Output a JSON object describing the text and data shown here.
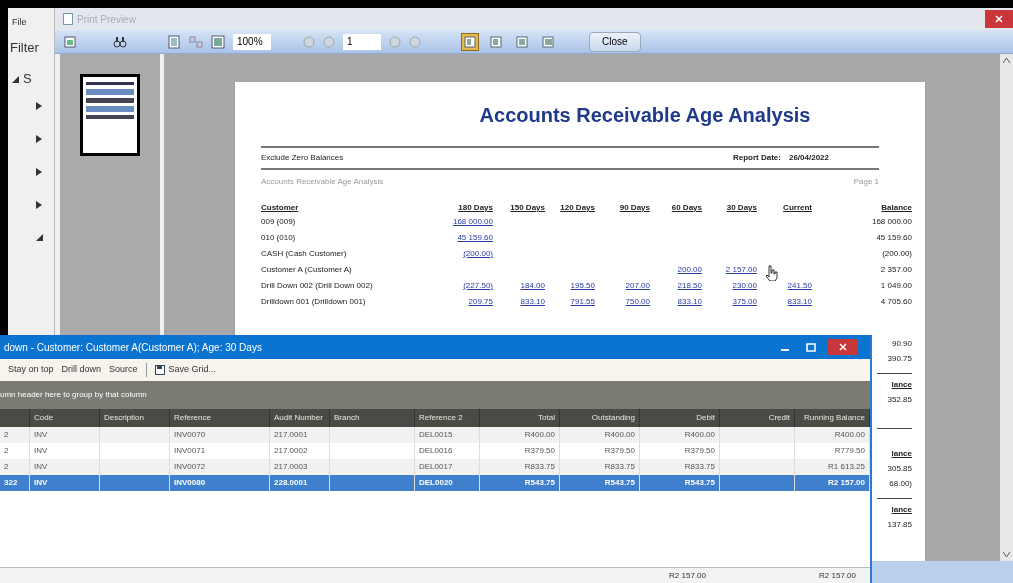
{
  "app_menu": {
    "file": "File",
    "filter": "Filter"
  },
  "tree": [
    {
      "label": "S",
      "expanded": true,
      "children": [
        {
          "expanded": false
        },
        {
          "expanded": false
        },
        {
          "expanded": false
        },
        {
          "expanded": false
        },
        {
          "expanded": true
        }
      ]
    }
  ],
  "preview": {
    "title": "Print Preview",
    "zoom": "100%",
    "page": "1",
    "close": "Close",
    "view_modes": [
      {
        "selected": true
      },
      {
        "selected": false
      },
      {
        "selected": false
      },
      {
        "selected": false
      }
    ]
  },
  "report": {
    "title": "Accounts Receivable Age Analysis",
    "filter": "Exclude Zero Balances",
    "report_date_label": "Report Date:",
    "report_date": "26/04/2022",
    "subtitle": "Accounts Receivable Age Analysis",
    "page": "Page 1",
    "columns": [
      "Customer",
      "180 Days",
      "150 Days",
      "120 Days",
      "90 Days",
      "60 Days",
      "30 Days",
      "Current",
      "Balance"
    ],
    "rows": [
      {
        "cells": [
          "009 (009)",
          "168 000.00",
          null,
          null,
          null,
          null,
          null,
          null,
          "168 000.00"
        ]
      },
      {
        "cells": [
          "010 (010)",
          "45 159.60",
          null,
          null,
          null,
          null,
          null,
          null,
          "45 159.60"
        ]
      },
      {
        "cells": [
          "CASH (Cash Customer)",
          "(200.00)",
          null,
          null,
          null,
          null,
          null,
          null,
          "(200.00)"
        ]
      },
      {
        "cells": [
          "Customer A (Customer A)",
          null,
          null,
          null,
          null,
          "200.00",
          "2 157.00",
          null,
          "2 357.00"
        ]
      },
      {
        "cells": [
          "Drill Down 002 (Drill Down 002)",
          "(227.50)",
          "184.00",
          "195.50",
          "207.00",
          "218.50",
          "230.00",
          "241.50",
          "1 049.00"
        ]
      },
      {
        "cells": [
          "Drilldown 001 (Drilldown 001)",
          "209.75",
          "833.10",
          "791.55",
          "750.00",
          "833.10",
          "375.00",
          "833.10",
          "4 705.60"
        ]
      }
    ],
    "fragments": [
      {
        "kind": "amount",
        "text": "90.90"
      },
      {
        "kind": "amount",
        "text": "390.75"
      },
      {
        "kind": "rule"
      },
      {
        "kind": "heading",
        "text": "lance"
      },
      {
        "kind": "amount",
        "text": "352.85"
      },
      {
        "kind": "gap"
      },
      {
        "kind": "rule"
      },
      {
        "kind": "gap"
      },
      {
        "kind": "heading",
        "text": "lance"
      },
      {
        "kind": "amount",
        "text": "305.85"
      },
      {
        "kind": "amount",
        "text": "68.00)"
      },
      {
        "kind": "rule"
      },
      {
        "kind": "heading",
        "text": "lance"
      },
      {
        "kind": "amount",
        "text": "137.85"
      }
    ]
  },
  "drilldown": {
    "title": "down - Customer: Customer A(Customer A); Age: 30 Days",
    "toolbar": [
      "Stay on top",
      "Drill down",
      "Source"
    ],
    "save": "Save Grid...",
    "group_hint": "umn header here to group by that column",
    "columns": [
      "Code",
      "Description",
      "Reference",
      "Audit Number",
      "Branch",
      "Reference 2",
      "Total",
      "Outstanding",
      "Debit",
      "Credit",
      "Running Balance"
    ],
    "rows": [
      {
        "selected": false,
        "row_label": "2",
        "cells": [
          "INV",
          null,
          "INV0070",
          "217.0001",
          null,
          "DEL0015",
          "R400.00",
          "R400.00",
          "R400.00",
          null,
          "R400.00"
        ]
      },
      {
        "selected": false,
        "row_label": "2",
        "cells": [
          "INV",
          null,
          "INV0071",
          "217.0002",
          null,
          "DEL0016",
          "R379.50",
          "R379.50",
          "R379.50",
          null,
          "R779.50"
        ]
      },
      {
        "selected": false,
        "row_label": "2",
        "cells": [
          "INV",
          null,
          "INV0072",
          "217.0003",
          null,
          "DEL0017",
          "R833.75",
          "R833.75",
          "R833.75",
          null,
          "R1 613.25"
        ]
      },
      {
        "selected": true,
        "row_label": "322",
        "cells": [
          "INV",
          null,
          "INV0080",
          "228.0001",
          null,
          "DEL0020",
          "R543.75",
          "R543.75",
          "R543.75",
          null,
          "R2 157.00"
        ]
      }
    ],
    "totals": {
      "debit": "R2 157.00",
      "running_balance": "R2 157.00"
    }
  }
}
